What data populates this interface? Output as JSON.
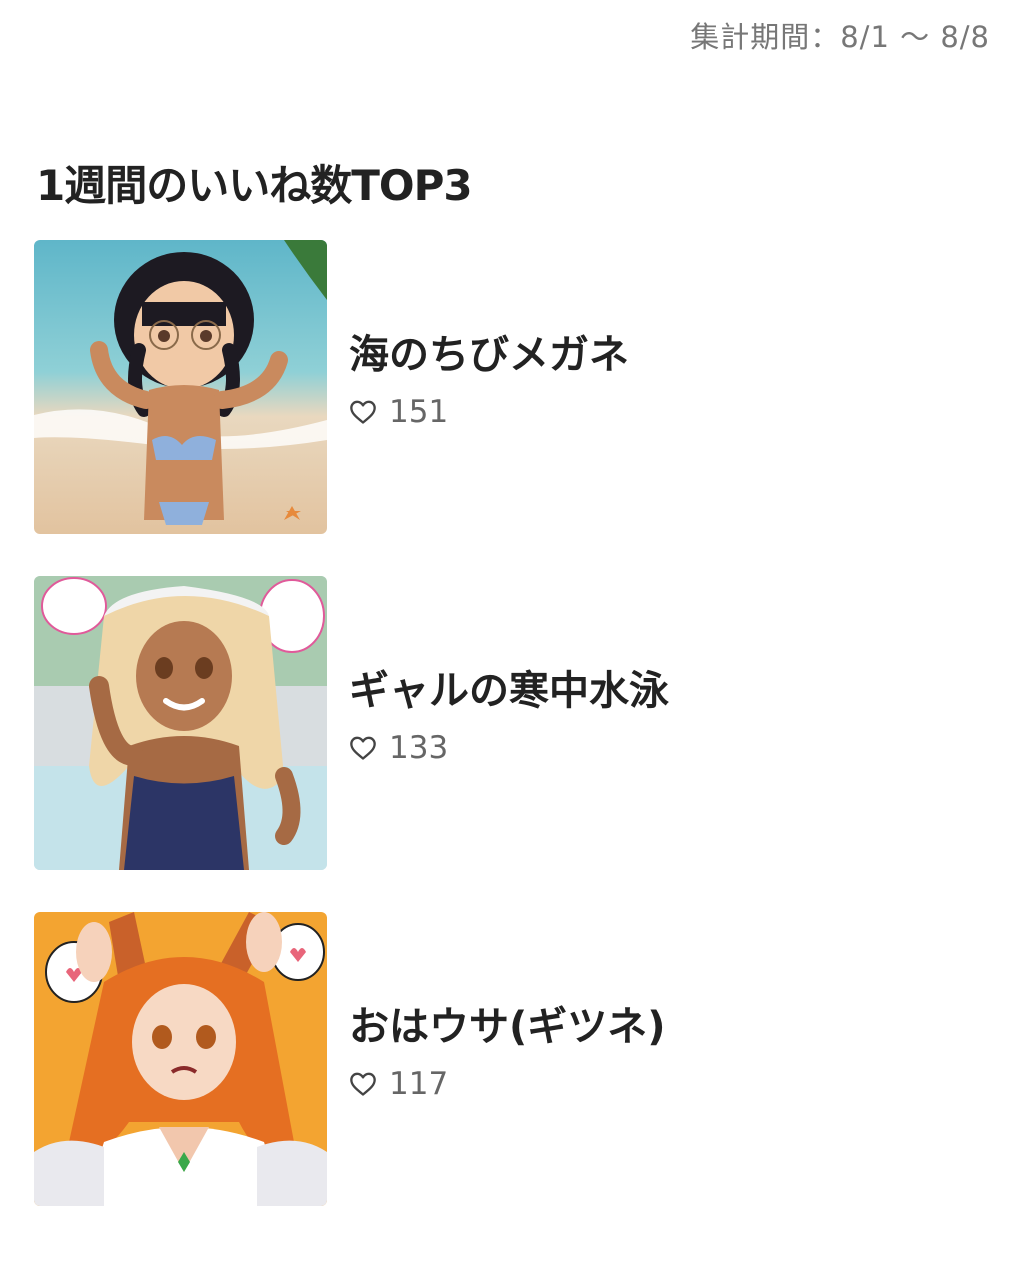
{
  "header": {
    "period_label": "集計期間：8/1 〜 8/8"
  },
  "section": {
    "title": "1週間のいいね数TOP3"
  },
  "items": [
    {
      "title": "海のちびメガネ",
      "likes": "151",
      "thumb_icon": "image-thumbnail"
    },
    {
      "title": "ギャルの寒中水泳",
      "likes": "133",
      "thumb_icon": "image-thumbnail"
    },
    {
      "title": "おはウサ(ギツネ)",
      "likes": "117",
      "thumb_icon": "image-thumbnail"
    }
  ],
  "colors": {
    "text": "#222222",
    "muted": "#777777",
    "likes": "#666666"
  }
}
